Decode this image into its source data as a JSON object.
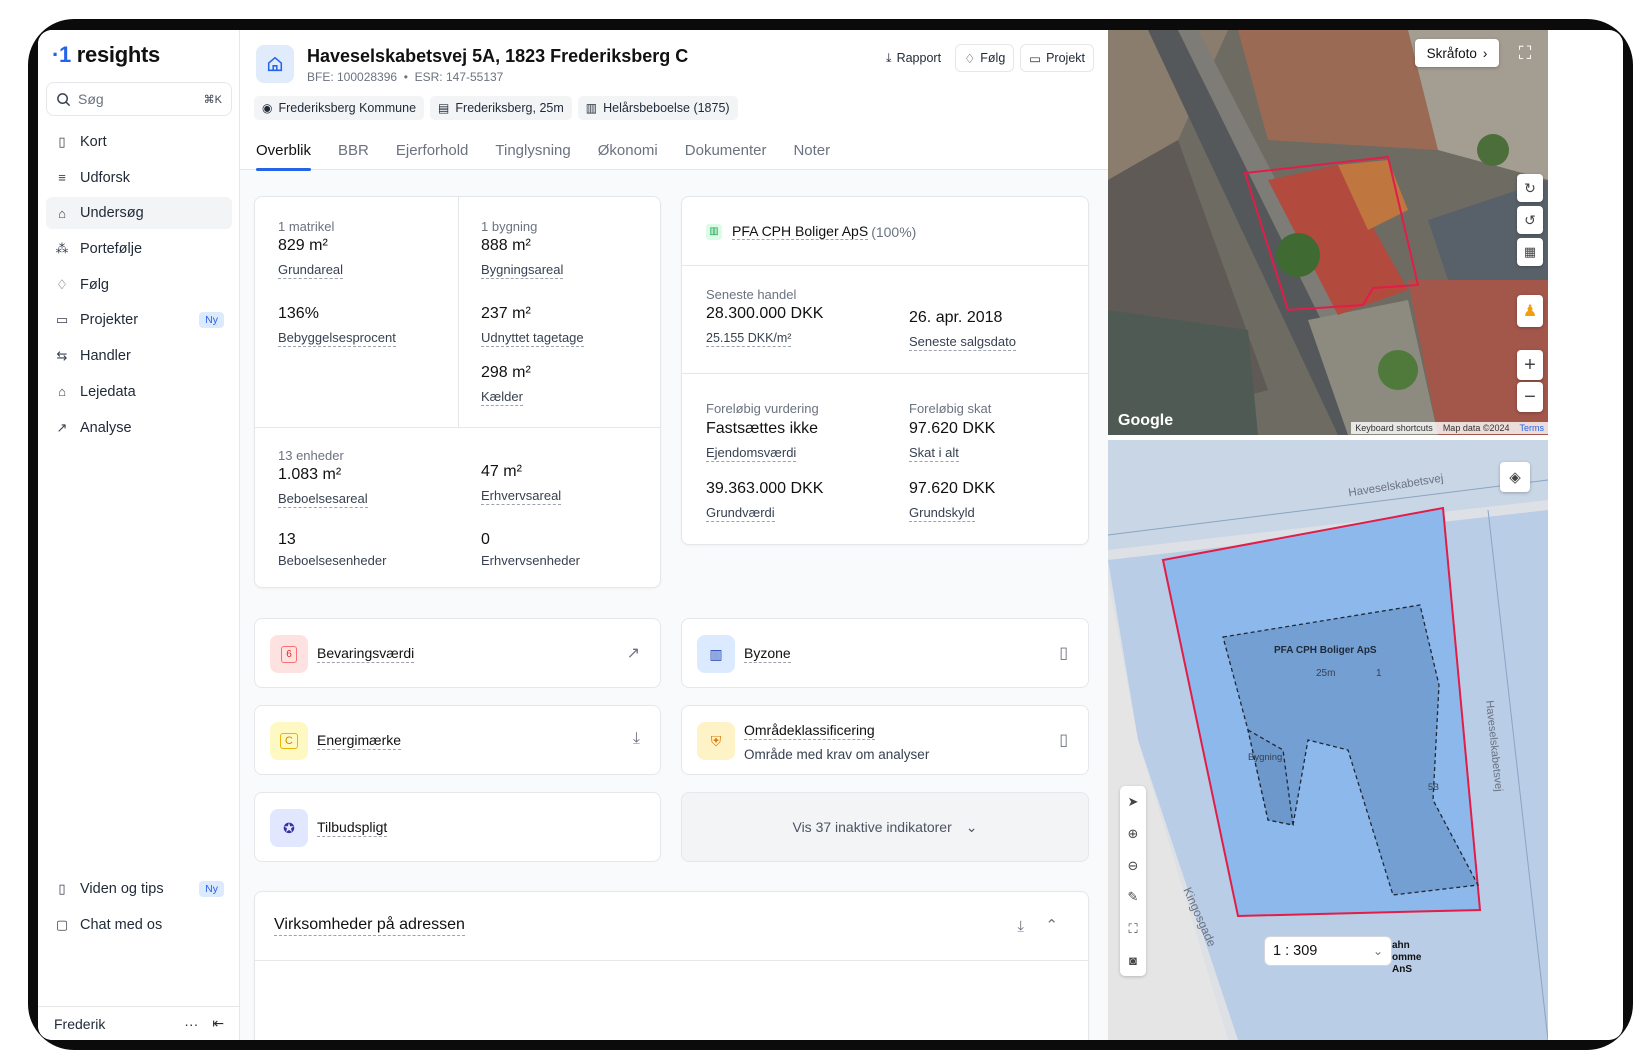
{
  "brand": {
    "name": "resights",
    "accent": "#2563eb"
  },
  "search": {
    "placeholder": "Søg",
    "shortcut": "⌘K"
  },
  "nav": [
    {
      "label": "Kort",
      "icon": "map-icon"
    },
    {
      "label": "Udforsk",
      "icon": "filter-icon"
    },
    {
      "label": "Undersøg",
      "icon": "home-icon",
      "active": true
    },
    {
      "label": "Portefølje",
      "icon": "portfolio-icon"
    },
    {
      "label": "Følg",
      "icon": "bell-icon"
    },
    {
      "label": "Projekter",
      "icon": "folder-icon",
      "badge": "Ny"
    },
    {
      "label": "Handler",
      "icon": "exchange-icon"
    },
    {
      "label": "Lejedata",
      "icon": "house-icon"
    },
    {
      "label": "Analyse",
      "icon": "chart-icon"
    }
  ],
  "nav_bottom": [
    {
      "label": "Viden og tips",
      "icon": "book-icon",
      "badge": "Ny"
    },
    {
      "label": "Chat med os",
      "icon": "chat-icon"
    }
  ],
  "user": {
    "name": "Frederik",
    "more": "···",
    "collapse": "⇤"
  },
  "property": {
    "title": "Haveselskabetsvej 5A, 1823 Frederiksberg C",
    "bfe": "BFE: 100028396",
    "esr": "ESR: 147-55137",
    "chips": [
      "Frederiksberg Kommune",
      "Frederiksberg, 25m",
      "Helårsbeboelse (1875)"
    ]
  },
  "actions": {
    "report": "Rapport",
    "follow": "Følg",
    "project": "Projekt"
  },
  "tabs": [
    "Overblik",
    "BBR",
    "Ejerforhold",
    "Tinglysning",
    "Økonomi",
    "Dokumenter",
    "Noter"
  ],
  "areas": {
    "matrikel": {
      "lab": "1 matrikel",
      "val": "829 m²",
      "cap": "Grundareal"
    },
    "bebyg": {
      "val": "136%",
      "cap": "Bebyggelsesprocent"
    },
    "bygning": {
      "lab": "1 bygning",
      "val": "888 m²",
      "cap": "Bygningsareal"
    },
    "tagetage": {
      "val": "237 m²",
      "cap": "Udnyttet tagetage"
    },
    "kaelder": {
      "val": "298 m²",
      "cap": "Kælder"
    },
    "enheder": {
      "lab": "13 enheder",
      "val": "1.083 m²",
      "cap": "Beboelsesareal"
    },
    "erhverv": {
      "val": "47 m²",
      "cap": "Erhvervsareal"
    },
    "bolig_enh": {
      "val": "13",
      "cap": "Beboelsesenheder"
    },
    "erhv_enh": {
      "val": "0",
      "cap": "Erhvervsenheder"
    }
  },
  "owner": {
    "name": "PFA CPH Boliger ApS",
    "share": "(100%)"
  },
  "trade": {
    "lab": "Seneste handel",
    "price": "28.300.000 DKK",
    "sqm": "25.155 DKK/m²",
    "date": "26. apr. 2018",
    "date_cap": "Seneste salgsdato"
  },
  "valuation": {
    "lab1": "Foreløbig vurdering",
    "val1": "Fastsættes ikke",
    "cap1": "Ejendomsværdi",
    "lab2": "Foreløbig skat",
    "val2": "97.620 DKK",
    "cap2": "Skat i alt",
    "val3": "39.363.000 DKK",
    "cap3": "Grundværdi",
    "val4": "97.620 DKK",
    "cap4": "Grundskyld"
  },
  "indicators": {
    "bevaring": {
      "title": "Bevaringsværdi",
      "icon_text": "6"
    },
    "byzone": {
      "title": "Byzone"
    },
    "energi": {
      "title": "Energimærke",
      "icon_text": "C"
    },
    "omraade": {
      "title": "Områdeklassificering",
      "sub": "Område med krav om analyser"
    },
    "tilbud": {
      "title": "Tilbudspligt"
    },
    "inactive": "Vis 37 inaktive indikatorer"
  },
  "businesses": {
    "title": "Virksomheder på adressen"
  },
  "map": {
    "aerial_button": "Skråfoto",
    "google": "Google",
    "footer": [
      "Keyboard shortcuts",
      "Map data ©2024",
      "Terms"
    ],
    "street_top": "Haveselskabetsvej",
    "street_right": "Haveselskabetsvej",
    "street_left": "Kingosgade",
    "owner_label": "PFA CPH Boliger ApS",
    "height_label": "25m",
    "floor_label": "1",
    "building_label": "Bygning",
    "house_label": "5B",
    "scale": "1 : 309",
    "corner_text": "ahn\nomme\nAnS"
  }
}
